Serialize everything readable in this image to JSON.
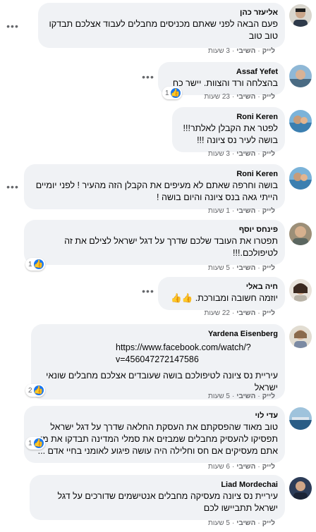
{
  "actions": {
    "like": "לייק",
    "reply": "השיבי"
  },
  "more_glyph": "•••",
  "comments": [
    {
      "author": "אליעזר כהן",
      "text": "פעם הבאה לפני שאתם מכניסים מחבלים לעבוד אצלכם תבדקו טוב טוב",
      "time": "3 שעות"
    },
    {
      "author": "Assaf Yefet",
      "text": "בהצלחה ורד והצוות. יישר כח",
      "time": "23 שעות",
      "reactions": "1"
    },
    {
      "author": "Roni Keren",
      "text": "לפטר את הקבלן לאלתר!!!\nבושה לעיר נס ציונה !!!",
      "time": "3 שעות"
    },
    {
      "author": "Roni Keren",
      "text": "בושה וחרפה שאתם לא מעיפים את הקבלן הזה מהעיר ! לפני יומיים הייתי גאה בנס ציונה והיום בושה !",
      "time": "1 שעות"
    },
    {
      "author": "פינחס יוסף",
      "text": "תפטרו את העובד שלכם שדרך על דגל ישראל לצילם את זה לטיפולכם.!!!",
      "time": "5 שעות",
      "reactions": "1"
    },
    {
      "author": "חיה באלי",
      "text": "יוזמה חשובה ומבורכת.",
      "emoji": "👍👍",
      "time": "22 שעות"
    },
    {
      "author": "Yardena Eisenberg",
      "link": "https://www.facebook.com/watch/?v=456047272147586",
      "text": "עיריית נס ציונה לטיפולכם בושה שעובדים אצלכם מחבלים שונאי ישראל",
      "time": "5 שעות",
      "reactions": "2"
    },
    {
      "author": "עדי לוי",
      "text": "טוב מאוד שהפסקתם את העסקת החלאה שדרך על דגל ישראל תפסיקו להעסיק מחבלים שמבזים את סמלי המדינה תבדקו את מי אתם מעסיקים אם חס וחלילה היה עושה פיגוע לאומני בחיי אדם ...",
      "time": "6 שעות",
      "reactions": "1"
    },
    {
      "author": "Liad Mordechai",
      "text": "עיריית נס ציונה מעסיקה מחבלים אנטישמים שדורכים על דגל ישראל תתביישו לכם",
      "time": "5 שעות"
    }
  ]
}
